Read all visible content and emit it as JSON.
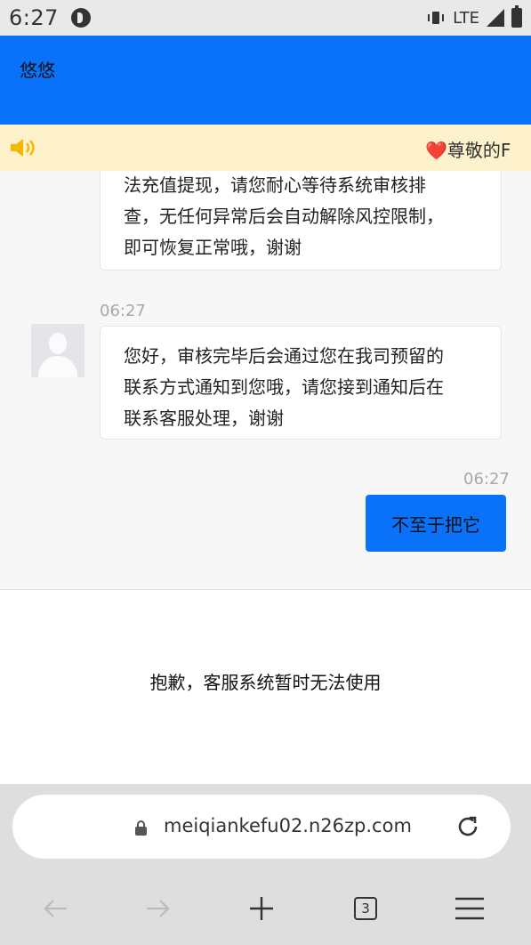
{
  "status_bar": {
    "time": "6:27",
    "network": "LTE",
    "icons": [
      "app-notification-icon",
      "vibrate-icon",
      "signal-icon",
      "battery-icon"
    ]
  },
  "header": {
    "title": "悠悠",
    "color": "#0a72f8"
  },
  "notice": {
    "icon": "speaker-icon",
    "text": "尊敬的F",
    "heart": "❤️",
    "background": "#fdf2cc"
  },
  "chat": {
    "messages": [
      {
        "from": "agent",
        "lines": [
          "法充值提现，请您耐心等待系统审核排",
          "查，无任何异常后会自动解除风控限制，",
          "即可恢复正常哦，谢谢"
        ]
      },
      {
        "from": "agent",
        "time": "06:27",
        "lines": [
          "您好，审核完毕后会通过您在我司预留的",
          "联系方式通知到您哦，请您接到通知后在",
          "联系客服处理，谢谢"
        ]
      },
      {
        "from": "user",
        "time": "06:27",
        "text": "不至于把它"
      }
    ]
  },
  "unavailable": {
    "text": "抱歉，客服系统暂时无法使用"
  },
  "browser": {
    "url": "meiqiankefu02.n26zp.com",
    "tab_count": "3",
    "nav_icons": [
      "back-arrow-icon",
      "forward-arrow-icon",
      "plus-icon",
      "tabs-icon",
      "menu-icon"
    ]
  }
}
